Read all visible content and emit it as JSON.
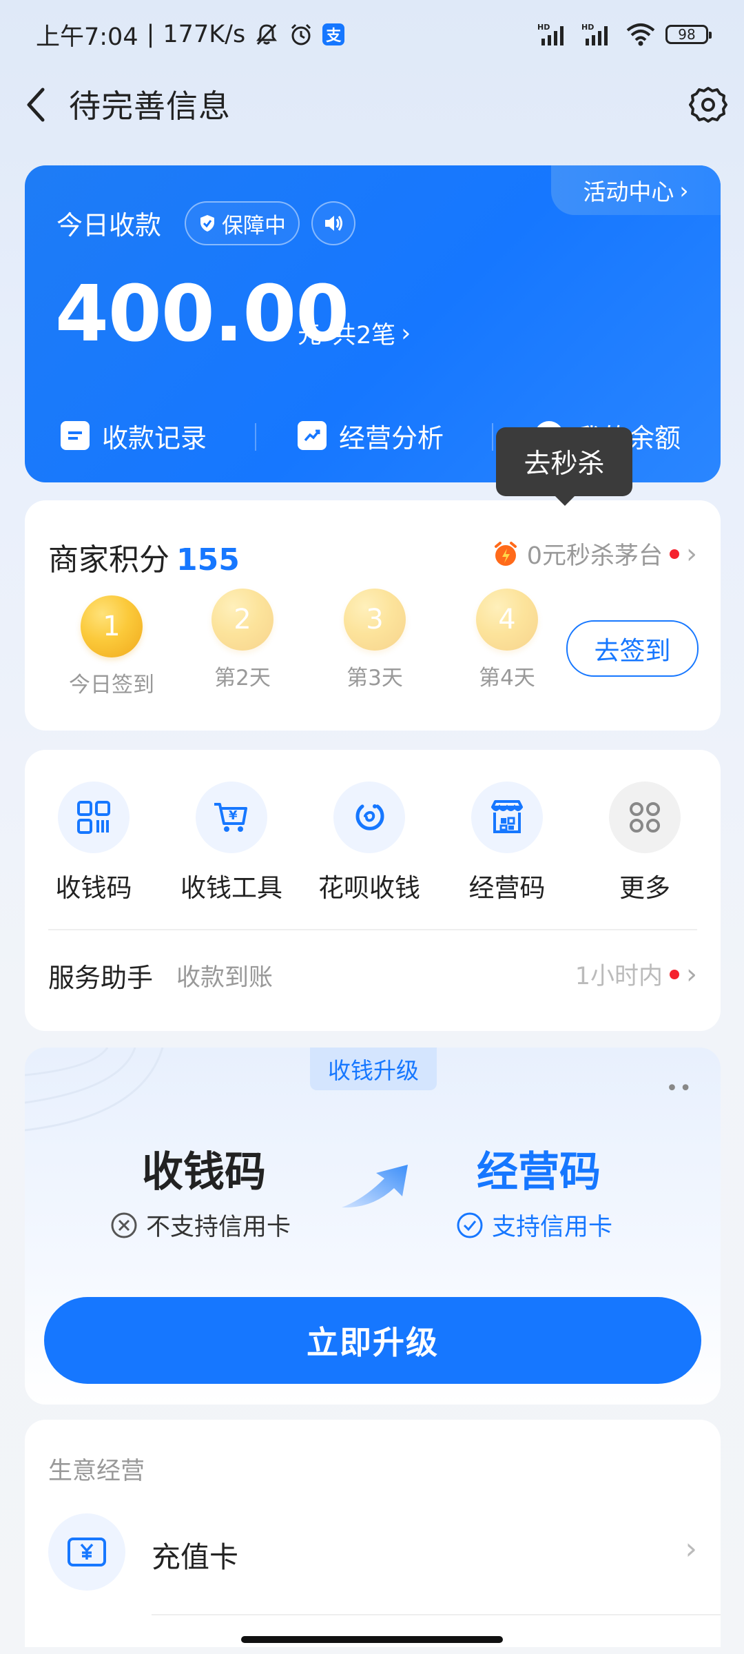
{
  "status_bar": {
    "time": "上午7:04",
    "speed": "177K/s",
    "battery": "98",
    "signal1": "HD",
    "signal2": "HD"
  },
  "header": {
    "title": "待完善信息"
  },
  "income_card": {
    "activity_center": "活动中心",
    "today_label": "今日收款",
    "guard_badge": "保障中",
    "amount": "400.00",
    "unit": "元",
    "count": "共2笔",
    "tools": [
      "收款记录",
      "经营分析",
      "我的余额"
    ]
  },
  "tooltip": {
    "text": "去秒杀"
  },
  "points_card": {
    "title": "商家积分",
    "value": "155",
    "promo": "0元秒杀茅台",
    "days": [
      {
        "num": "1",
        "label": "今日签到"
      },
      {
        "num": "2",
        "label": "第2天"
      },
      {
        "num": "3",
        "label": "第3天"
      },
      {
        "num": "4",
        "label": "第4天"
      }
    ],
    "signin_button": "去签到"
  },
  "tools_card": {
    "apps": [
      {
        "label": "收钱码",
        "icon": "qr-code-icon"
      },
      {
        "label": "收钱工具",
        "icon": "cart-yuan-icon"
      },
      {
        "label": "花呗收钱",
        "icon": "huabei-icon"
      },
      {
        "label": "经营码",
        "icon": "store-code-icon"
      },
      {
        "label": "更多",
        "icon": "more-grid-icon"
      }
    ],
    "assistant_title": "服务助手",
    "assistant_sub": "收款到账",
    "assistant_time": "1小时内"
  },
  "upgrade_card": {
    "tag": "收钱升级",
    "more": "••",
    "old_code": "收钱码",
    "old_note": "不支持信用卡",
    "new_code": "经营码",
    "new_note": "支持信用卡",
    "button": "立即升级"
  },
  "business_card": {
    "title": "生意经营",
    "item": "充值卡"
  },
  "colors": {
    "accent": "#1677ff",
    "danger_dot": "#f5222d",
    "coin": "#fbc93a"
  }
}
